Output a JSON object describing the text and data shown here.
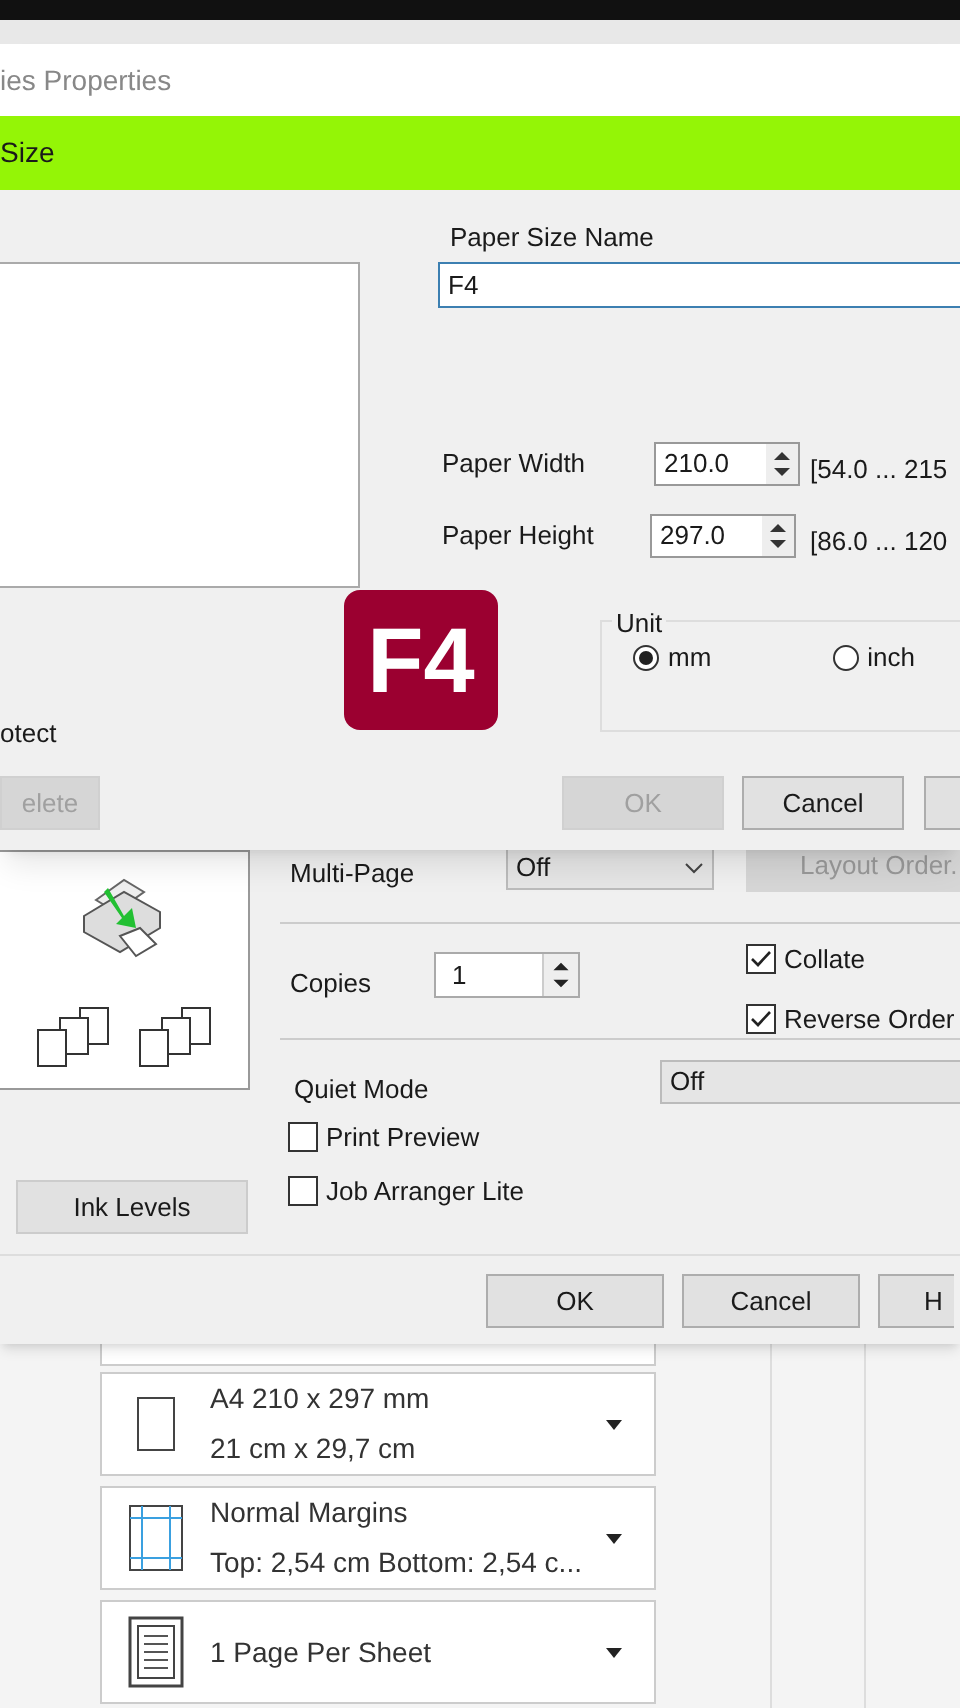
{
  "back_window": {
    "title": "ies Properties"
  },
  "paper_dialog": {
    "title": "Size",
    "name_label": "Paper Size Name",
    "name_value": "F4",
    "width_label": "Paper Width",
    "width_value": "210.0",
    "width_range": "[54.0 ... 215",
    "height_label": "Paper Height",
    "height_value": "297.0",
    "height_range": "[86.0 ... 120",
    "unit_label": "Unit",
    "units": [
      {
        "label": "mm",
        "selected": true
      },
      {
        "label": "inch",
        "selected": false
      }
    ],
    "protect_label": "otect",
    "buttons": [
      {
        "label": "elete",
        "disabled": true
      },
      {
        "label": "OK",
        "disabled": true
      },
      {
        "label": "Cancel",
        "disabled": false
      },
      {
        "disabled": false
      }
    ]
  },
  "overlay_badge": "F4",
  "printer_properties": {
    "multi_page_label": "Multi-Page",
    "multi_page_value": "Off",
    "layout_order_button": "Layout Order.",
    "copies_label": "Copies",
    "copies_value": "1",
    "checks_right": [
      {
        "label": "Collate",
        "checked": true
      },
      {
        "label": "Reverse Order",
        "checked": true
      }
    ],
    "quiet_mode_label": "Quiet Mode",
    "quiet_mode_value": "Off",
    "checks_left": [
      {
        "label": "Print Preview",
        "checked": false
      },
      {
        "label": "Job Arranger Lite",
        "checked": false
      }
    ],
    "ink_levels_button": "Ink Levels",
    "buttons": [
      "OK",
      "Cancel",
      "H"
    ]
  },
  "print_settings": [
    {
      "kind": "paper",
      "line_1": "A4 210 x 297 mm",
      "line_2": "21 cm x 29,7 cm"
    },
    {
      "kind": "margins",
      "line_1": "Normal Margins",
      "line_2": "Top: 2,54 cm Bottom: 2,54 c..."
    },
    {
      "kind": "pages",
      "line_1": "1 Page Per Sheet"
    }
  ]
}
